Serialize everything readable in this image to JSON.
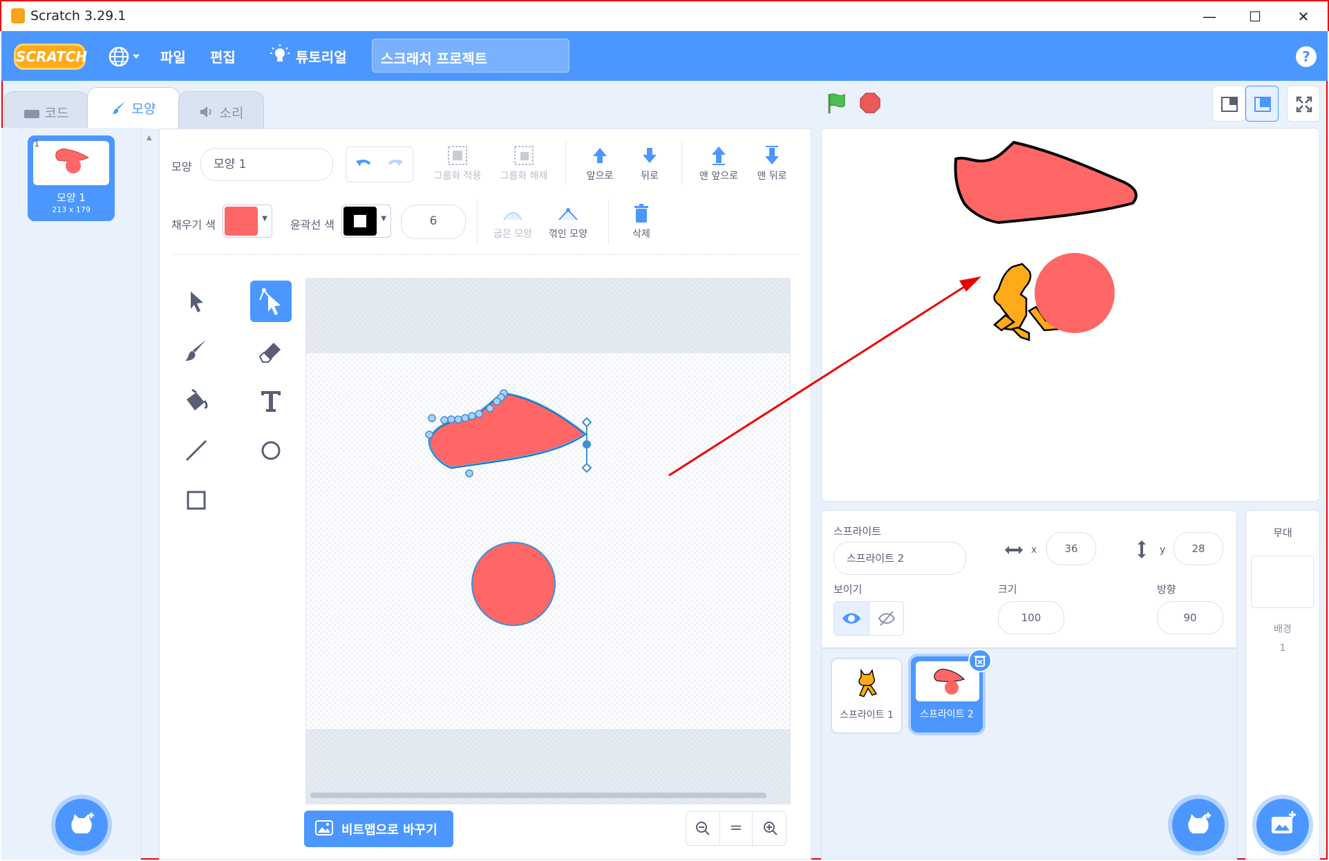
{
  "window": {
    "title": "Scratch 3.29.1",
    "minimize": "—",
    "maximize": "☐",
    "close": "✕"
  },
  "menubar": {
    "logo": "SCRATCH",
    "file": "파일",
    "edit": "편집",
    "tutorial": "튜토리얼",
    "project_title": "스크래치 프로젝트",
    "help": "?"
  },
  "tabs": {
    "code": "코드",
    "costumes": "모양",
    "sounds": "소리"
  },
  "costume_list": [
    {
      "index": "1",
      "name": "모양 1",
      "size": "213 x 179"
    }
  ],
  "editor": {
    "costume_label": "모양",
    "costume_name": "모양 1",
    "group": "그룹화 적용",
    "ungroup": "그룹화 해제",
    "forward": "앞으로",
    "backward": "뒤로",
    "front": "맨 앞으로",
    "back": "맨 뒤로",
    "fill_label": "채우기 색",
    "fill_color": "#ff6666",
    "outline_label": "윤곽선 색",
    "outline_color": "#000000",
    "outline_width": "6",
    "curved": "굽은 모양",
    "pointed": "꺾인 모양",
    "delete": "삭제",
    "convert_bitmap": "비트맵으로 바꾸기",
    "zoom_reset": "="
  },
  "sprite_info": {
    "sprite_label": "스프라이트",
    "sprite_name": "스프라이트 2",
    "x_label": "x",
    "x": "36",
    "y_label": "y",
    "y": "28",
    "show_label": "보이기",
    "size_label": "크기",
    "size": "100",
    "direction_label": "방향",
    "direction": "90"
  },
  "sprites": [
    {
      "name": "스프라이트 1"
    },
    {
      "name": "스프라이트 2"
    }
  ],
  "stage_panel": {
    "label": "무대",
    "backdrop_label": "배경",
    "backdrop_count": "1"
  },
  "colors": {
    "accent": "#4c97ff",
    "costume_fill": "#ff6666",
    "annotation": "#e00000"
  }
}
